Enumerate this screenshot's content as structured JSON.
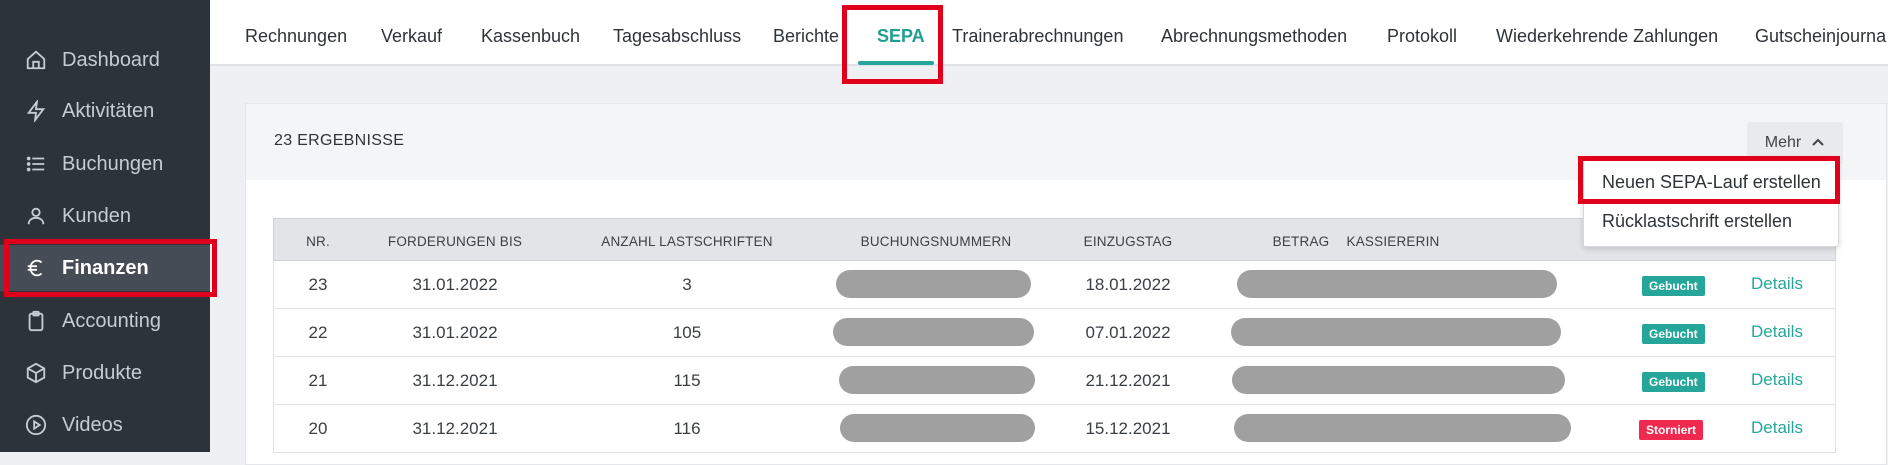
{
  "sidebar": {
    "items": [
      {
        "label": "Dashboard",
        "icon": "home-icon"
      },
      {
        "label": "Aktivitäten",
        "icon": "lightning-icon"
      },
      {
        "label": "Buchungen",
        "icon": "list-icon"
      },
      {
        "label": "Kunden",
        "icon": "user-icon"
      },
      {
        "label": "Finanzen",
        "icon": "euro-icon",
        "active": true
      },
      {
        "label": "Accounting",
        "icon": "clipboard-icon"
      },
      {
        "label": "Produkte",
        "icon": "box-icon"
      },
      {
        "label": "Videos",
        "icon": "play-circle-icon"
      }
    ]
  },
  "tabs": [
    {
      "label": "Rechnungen"
    },
    {
      "label": "Verkauf"
    },
    {
      "label": "Kassenbuch"
    },
    {
      "label": "Tagesabschluss"
    },
    {
      "label": "Berichte"
    },
    {
      "label": "SEPA",
      "active": true
    },
    {
      "label": "Trainerabrechnungen"
    },
    {
      "label": "Abrechnungsmethoden"
    },
    {
      "label": "Protokoll"
    },
    {
      "label": "Wiederkehrende Zahlungen"
    },
    {
      "label": "Gutscheinjourna"
    }
  ],
  "card": {
    "results": "23 ERGEBNISSE",
    "more_label": "Mehr"
  },
  "dropdown": {
    "items": [
      "Neuen SEPA-Lauf erstellen",
      "Rücklastschrift erstellen"
    ]
  },
  "table": {
    "headers": [
      "NR.",
      "FORDERUNGEN BIS",
      "ANZAHL LASTSCHRIFTEN",
      "BUCHUNGSNUMMERN",
      "EINZUGSTAG",
      "BETRAG",
      "KASSIERERIN"
    ],
    "rows": [
      {
        "nr": "23",
        "forderungen_bis": "31.01.2022",
        "anzahl": "3",
        "einzugstag": "18.01.2022",
        "status": "Gebucht",
        "action": "Details"
      },
      {
        "nr": "22",
        "forderungen_bis": "31.01.2022",
        "anzahl": "105",
        "einzugstag": "07.01.2022",
        "status": "Gebucht",
        "action": "Details"
      },
      {
        "nr": "21",
        "forderungen_bis": "31.12.2021",
        "anzahl": "115",
        "einzugstag": "21.12.2021",
        "status": "Gebucht",
        "action": "Details"
      },
      {
        "nr": "20",
        "forderungen_bis": "31.12.2021",
        "anzahl": "116",
        "einzugstag": "15.12.2021",
        "status": "Storniert",
        "action": "Details"
      }
    ]
  },
  "colors": {
    "accent": "#26a69a",
    "gebucht": "#26a69a",
    "storniert": "#f0294f",
    "highlight": "#e0001b",
    "sidebar_bg": "#2d333b"
  }
}
